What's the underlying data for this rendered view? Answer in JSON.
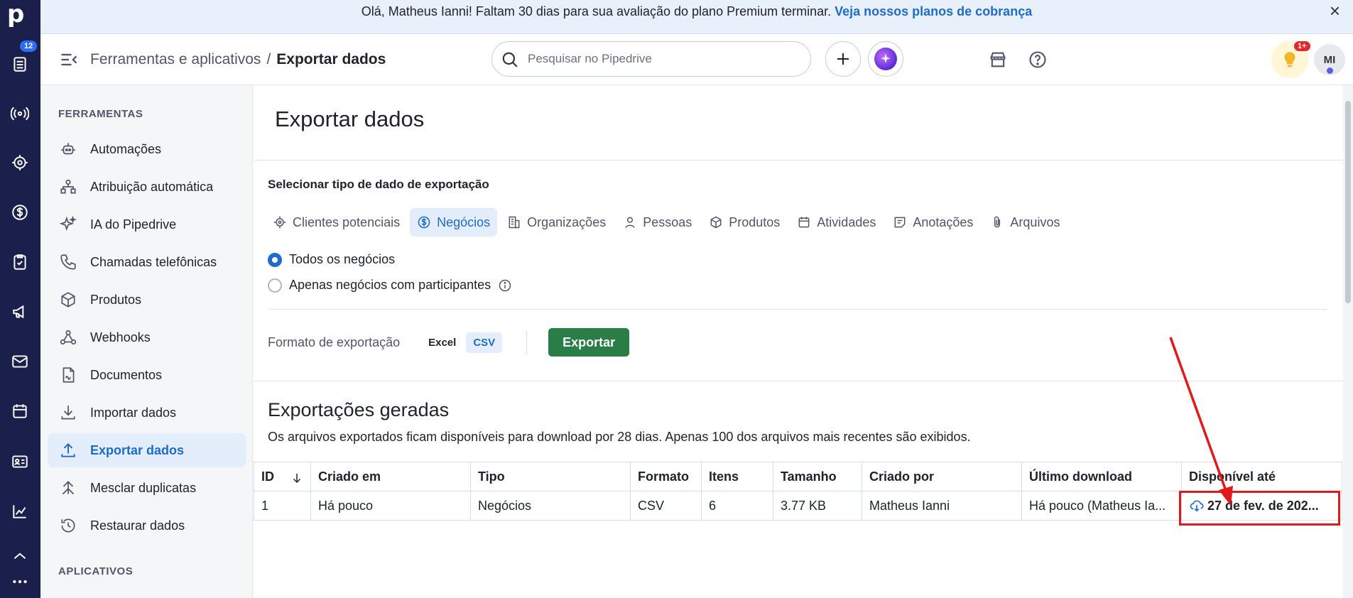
{
  "app": {
    "logo_letter": "p",
    "rail_badge": "12"
  },
  "rail_icons": [
    "activities-list-icon",
    "broadcast-icon",
    "target-icon",
    "dollar-icon",
    "clipboard-check-icon",
    "megaphone-icon",
    "mail-icon",
    "calendar-icon",
    "contacts-card-icon",
    "chart-icon",
    "chevron-up-icon",
    "more-dots-icon"
  ],
  "banner": {
    "text": "Olá, Matheus Ianni! Faltam 30 dias para sua avaliação do plano Premium terminar. ",
    "link": "Veja nossos planos de cobrança",
    "close": "×"
  },
  "topbar": {
    "crumb_parent": "Ferramentas e aplicativos",
    "crumb_sep": "/",
    "crumb_current": "Exportar dados",
    "search_placeholder": "Pesquisar no Pipedrive",
    "tips_badge": "1+",
    "avatar_initials": "MI"
  },
  "sidebar": {
    "section1": "FERRAMENTAS",
    "section2": "APLICATIVOS",
    "items": [
      {
        "label": "Automações",
        "icon": "robot-icon"
      },
      {
        "label": "Atribuição automática",
        "icon": "assignment-icon"
      },
      {
        "label": "IA do Pipedrive",
        "icon": "sparkles-icon"
      },
      {
        "label": "Chamadas telefônicas",
        "icon": "phone-icon"
      },
      {
        "label": "Produtos",
        "icon": "box-icon"
      },
      {
        "label": "Webhooks",
        "icon": "webhook-icon"
      },
      {
        "label": "Documentos",
        "icon": "document-icon"
      },
      {
        "label": "Importar dados",
        "icon": "download-icon"
      },
      {
        "label": "Exportar dados",
        "icon": "upload-icon"
      },
      {
        "label": "Mesclar duplicatas",
        "icon": "merge-icon"
      },
      {
        "label": "Restaurar dados",
        "icon": "restore-icon"
      }
    ]
  },
  "main": {
    "title": "Exportar dados",
    "select_type_label": "Selecionar tipo de dado de exportação",
    "types": [
      "Clientes potenciais",
      "Negócios",
      "Organizações",
      "Pessoas",
      "Produtos",
      "Atividades",
      "Anotações",
      "Arquivos"
    ],
    "radio_all": "Todos os negócios",
    "radio_participants": "Apenas negócios com participantes",
    "format_label": "Formato de exportação",
    "format_excel": "Excel",
    "format_csv": "CSV",
    "export_button": "Exportar",
    "generated_title": "Exportações geradas",
    "generated_desc": "Os arquivos exportados ficam disponíveis para download por 28 dias. Apenas 100 dos arquivos mais recentes são exibidos.",
    "table": {
      "headers": [
        "ID",
        "Criado em",
        "Tipo",
        "Formato",
        "Itens",
        "Tamanho",
        "Criado por",
        "Último download",
        "Disponível até"
      ],
      "row": [
        "1",
        "Há pouco",
        "Negócios",
        "CSV",
        "6",
        "3.77 KB",
        "Matheus Ianni",
        "Há pouco (Matheus Ia...",
        "27 de fev. de 202..."
      ]
    }
  },
  "colors": {
    "rail": "#1b1f4b",
    "accent": "#1e6cc5",
    "export_green": "#2a7d46",
    "highlight_red": "#e0191b"
  }
}
